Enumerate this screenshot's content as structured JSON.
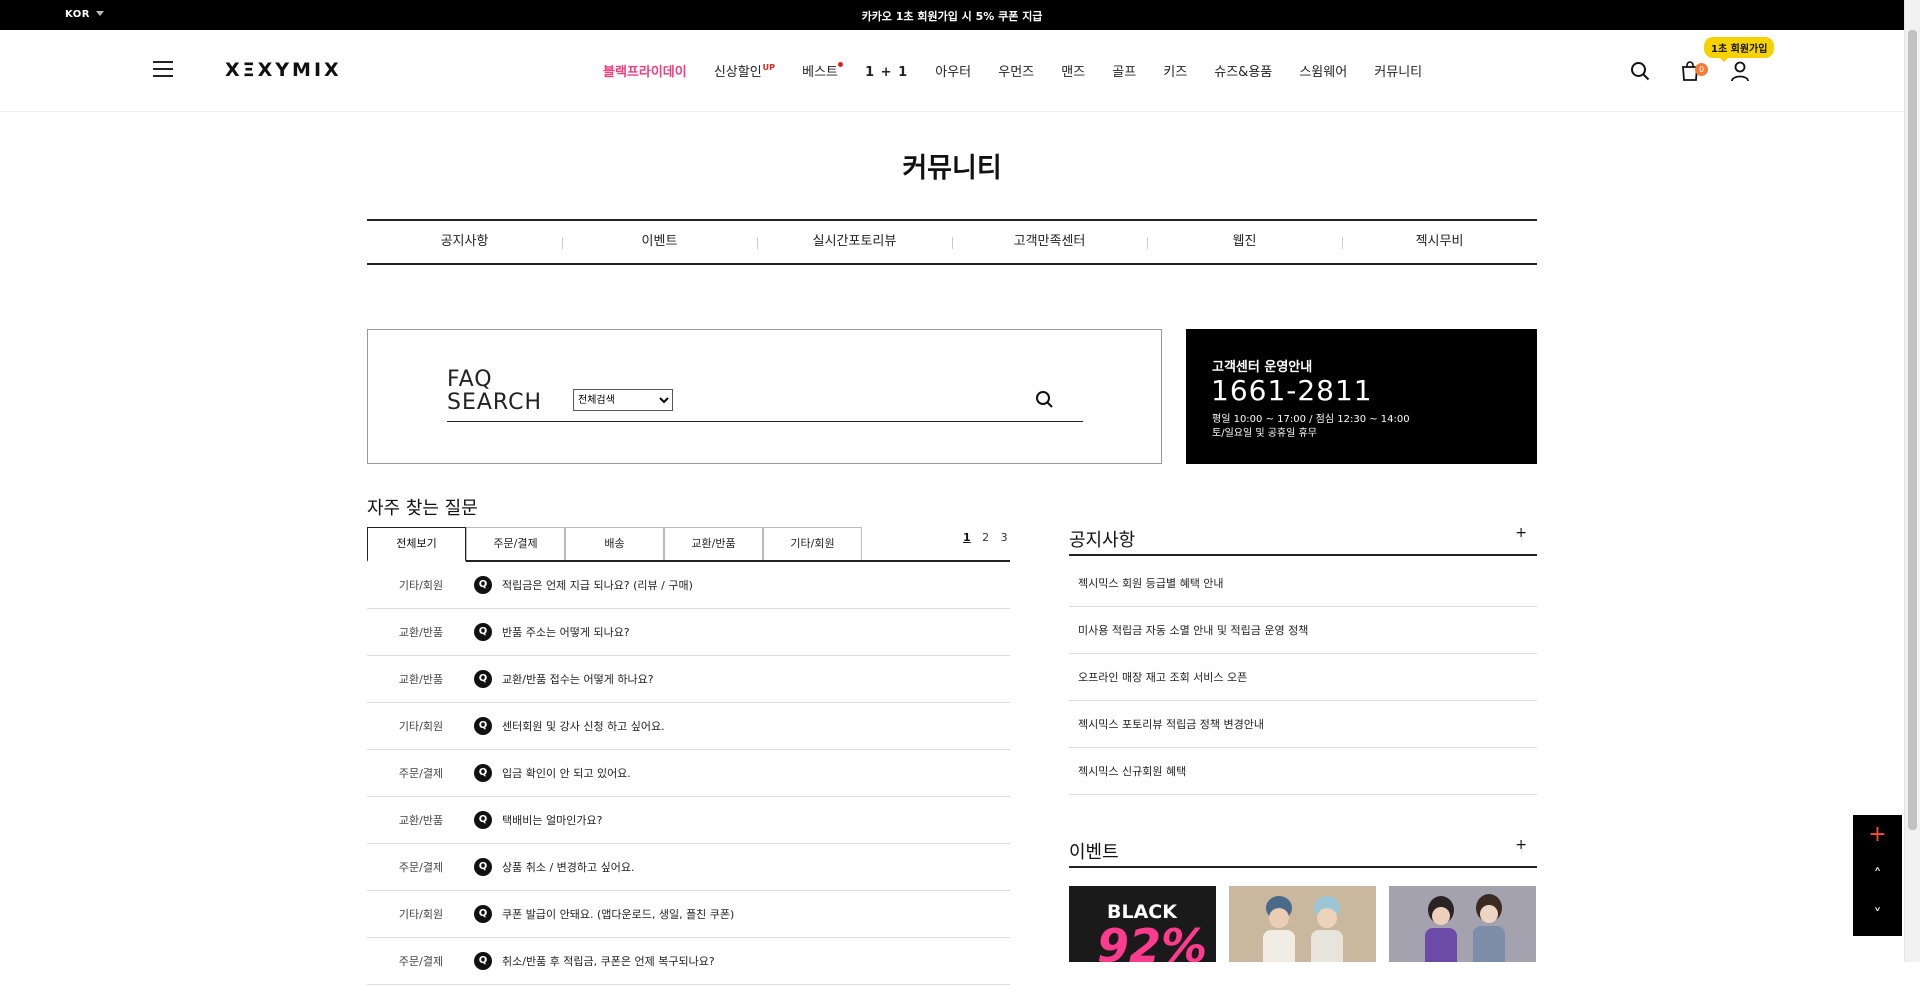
{
  "topbar": {
    "lang": "KOR",
    "promo": "카카오 1초 회원가입 시 5% 쿠폰 지급"
  },
  "header": {
    "logo": "XΞXYMIX",
    "nav": [
      {
        "label": "블랙프라이데이"
      },
      {
        "label": "신상할인",
        "badge": "UP"
      },
      {
        "label": "베스트"
      },
      {
        "label": "1 + 1"
      },
      {
        "label": "아우터"
      },
      {
        "label": "우먼즈"
      },
      {
        "label": "맨즈"
      },
      {
        "label": "골프"
      },
      {
        "label": "키즈"
      },
      {
        "label": "슈즈&용품"
      },
      {
        "label": "스윔웨어"
      },
      {
        "label": "커뮤니티"
      }
    ],
    "cart_count": "0",
    "join_tooltip": "1초 회원가입"
  },
  "page_title": "커뮤니티",
  "subnav": [
    "공지사항",
    "이벤트",
    "실시간포토리뷰",
    "고객만족센터",
    "웹진",
    "젝시무비"
  ],
  "faq_search": {
    "label_line1": "FAQ",
    "label_line2": "SEARCH",
    "select_value": "전체검색",
    "placeholder": ""
  },
  "customer_center": {
    "title": "고객센터 운영안내",
    "phone": "1661-2811",
    "hours": "평일 10:00 ~ 17:00 / 점심 12:30 ~ 14:00",
    "closed": "토/일요일 및 공휴일 휴무"
  },
  "faq": {
    "title": "자주 찾는 질문",
    "tabs": [
      "전체보기",
      "주문/결제",
      "배송",
      "교환/반품",
      "기타/회원"
    ],
    "pages": [
      "1",
      "2",
      "3"
    ],
    "items": [
      {
        "cat": "기타/회원",
        "q": "Q",
        "text": "적립금은 언제 지급 되나요? (리뷰 / 구매)"
      },
      {
        "cat": "교환/반품",
        "q": "Q",
        "text": "반품 주소는 어떻게 되나요?"
      },
      {
        "cat": "교환/반품",
        "q": "Q",
        "text": "교환/반품 접수는 어떻게 하나요?"
      },
      {
        "cat": "기타/회원",
        "q": "Q",
        "text": "센터회원 및 강사 신청 하고 싶어요."
      },
      {
        "cat": "주문/결제",
        "q": "Q",
        "text": "입금 확인이 안 되고 있어요."
      },
      {
        "cat": "교환/반품",
        "q": "Q",
        "text": "택배비는 얼마인가요?"
      },
      {
        "cat": "주문/결제",
        "q": "Q",
        "text": "상품 취소 / 변경하고 싶어요."
      },
      {
        "cat": "기타/회원",
        "q": "Q",
        "text": "쿠폰 발급이 안돼요. (앱다운로드, 생일, 플친 쿠폰)"
      },
      {
        "cat": "주문/결제",
        "q": "Q",
        "text": "취소/반품 후 적립금, 쿠폰은 언제 복구되나요?"
      }
    ]
  },
  "notice": {
    "title": "공지사항",
    "plus": "+",
    "items": [
      "젝시믹스 회원 등급별 혜택 안내",
      "미사용 적립금 자동 소멸 안내 및 적립금 운영 정책",
      "오프라인 매장 재고 조회 서비스 오픈",
      "젝시믹스 포토리뷰 적립금 정책 변경안내",
      "젝시믹스 신규회원 혜택"
    ]
  },
  "events": {
    "title": "이벤트",
    "plus": "+",
    "thumb1_text1": "BLACK",
    "thumb1_text2": "92%"
  },
  "float_buttons": {
    "plus": "+",
    "up": "˄",
    "down": "˅"
  }
}
